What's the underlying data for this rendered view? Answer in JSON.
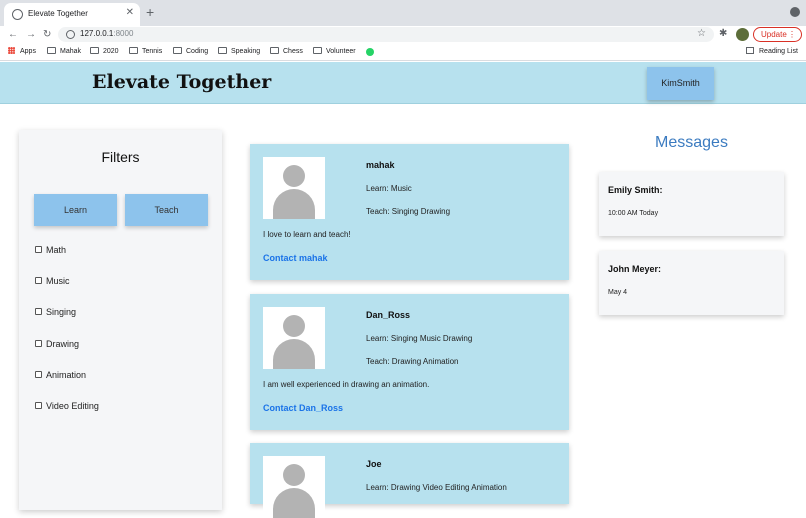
{
  "browser": {
    "tab_title": "Elevate Together",
    "url_host": "127.0.0.1",
    "url_port": ":8000",
    "update_label": "Update",
    "bookmarks": [
      "Apps",
      "Mahak",
      "2020",
      "Tennis",
      "Coding",
      "Speaking",
      "Chess",
      "Volunteer"
    ],
    "reading_list": "Reading List"
  },
  "header": {
    "site_title": "Elevate Together",
    "user_button": "KimSmith",
    "background": "#b7e1ee"
  },
  "filters": {
    "title": "Filters",
    "learn_button": "Learn",
    "teach_button": "Teach",
    "options": [
      "Math",
      "Music",
      "Singing",
      "Drawing",
      "Animation",
      "Video Editing"
    ]
  },
  "profiles": [
    {
      "name": "mahak",
      "learn": "Learn: Music",
      "teach": "Teach: Singing Drawing",
      "bio": "I love to learn and teach!",
      "contact": "Contact mahak"
    },
    {
      "name": "Dan_Ross",
      "learn": "Learn: Singing Music Drawing",
      "teach": "Teach: Drawing Animation",
      "bio": "I am well experienced in drawing an animation.",
      "contact": "Contact Dan_Ross"
    },
    {
      "name": "Joe",
      "learn": "Learn: Drawing Video Editing Animation",
      "teach": "",
      "bio": "",
      "contact": ""
    }
  ],
  "messages": {
    "title": "Messages",
    "items": [
      {
        "name": "Emily Smith:",
        "time": "10:00 AM Today"
      },
      {
        "name": "John Meyer:",
        "time": "May 4"
      }
    ]
  },
  "colors": {
    "accent_blue": "#8dc3ec",
    "link_blue": "#1a73e8",
    "messages_title": "#3b7bc0"
  }
}
